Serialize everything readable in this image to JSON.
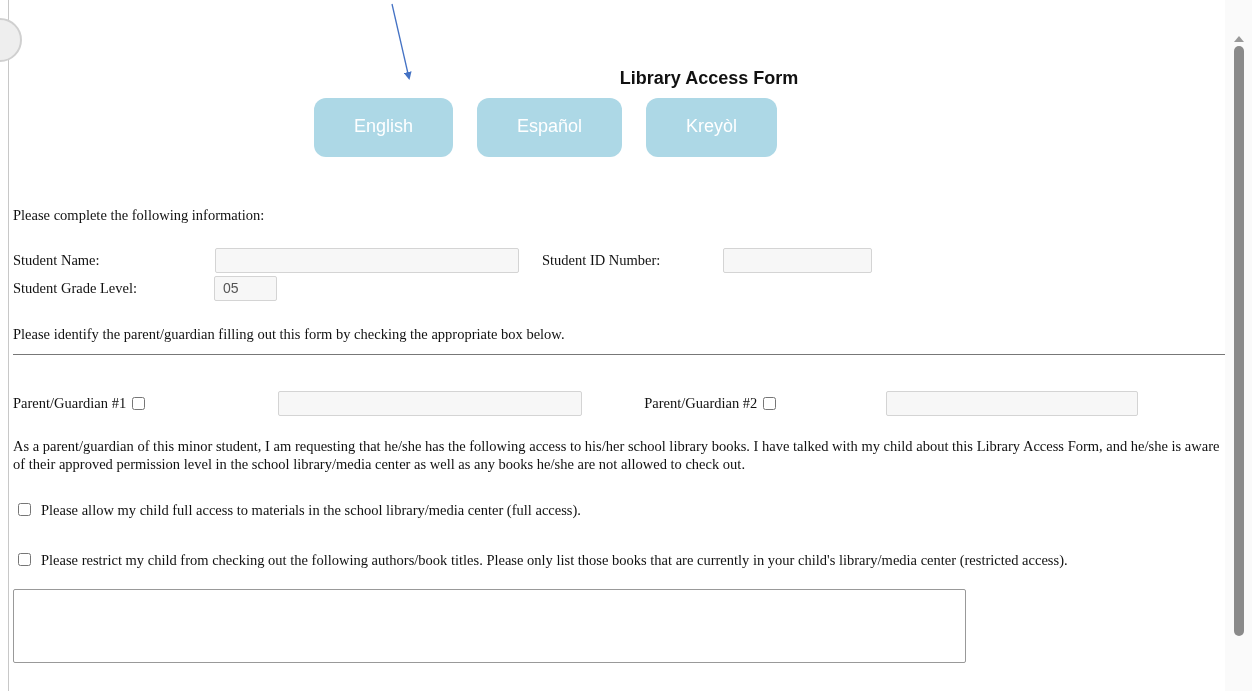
{
  "title": "Library Access Form",
  "languages": [
    {
      "label": "English",
      "selected": false
    },
    {
      "label": "Español",
      "selected": false
    },
    {
      "label": "Kreyòl",
      "selected": false
    }
  ],
  "intro": "Please complete the following information:",
  "student": {
    "name_label": "Student Name:",
    "id_label": "Student ID Number:",
    "grade_label": "Student Grade Level:",
    "grade_value": "05"
  },
  "identify_text": "Please identify the parent/guardian filling out this form by checking the appropriate box below.",
  "guardians": [
    {
      "label": "Parent/Guardian #1",
      "checked": false
    },
    {
      "label": "Parent/Guardian #2",
      "checked": false
    }
  ],
  "statement": "As a parent/guardian of this minor student, I am requesting that he/she has the following access to his/her school library books.  I have talked with my child about this Library Access Form, and he/she is aware of their approved permission level in the school library/media center as well as any books he/she are not allowed to check out.",
  "options": [
    {
      "label": "Please allow my child full access to materials in the school library/media center (full access).",
      "checked": false
    },
    {
      "label": "Please restrict my child from checking out the following authors/book titles.  Please only list those books that are currently in your child's library/media center (restricted access).",
      "checked": false
    }
  ]
}
